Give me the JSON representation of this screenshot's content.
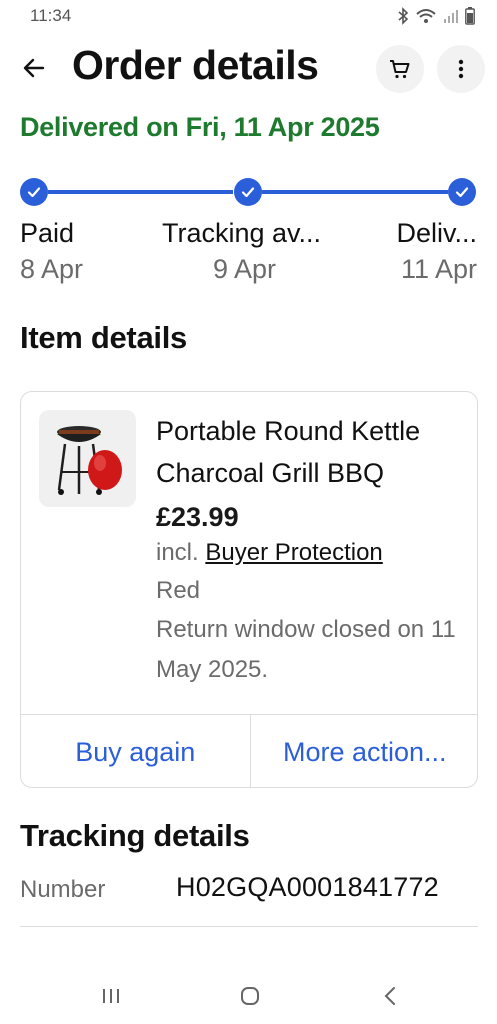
{
  "status_bar": {
    "time": "11:34"
  },
  "header": {
    "title": "Order details"
  },
  "delivery": {
    "status": "Delivered on Fri, 11 Apr 2025"
  },
  "tracker": {
    "color": "#2b5fd9",
    "steps": [
      {
        "label": "Paid",
        "date": "8 Apr"
      },
      {
        "label": "Tracking av...",
        "date": "9 Apr"
      },
      {
        "label": "Deliv...",
        "date": "11 Apr"
      }
    ]
  },
  "item_details": {
    "title": "Item details",
    "item": {
      "name": "Portable Round Kettle Charcoal Grill BBQ",
      "price": "£23.99",
      "incl_prefix": "incl.",
      "buyer_protection": "Buyer Protection",
      "variant": "Red",
      "return_note": "Return window closed on 11 May 2025."
    },
    "actions": {
      "buy_again": "Buy again",
      "more_actions": "More action..."
    }
  },
  "tracking_details": {
    "title": "Tracking details",
    "number_label": "Number",
    "number_value": "H02GQA0001841772"
  },
  "colors": {
    "accent": "#2b5fd9",
    "success": "#1e7a2e"
  }
}
